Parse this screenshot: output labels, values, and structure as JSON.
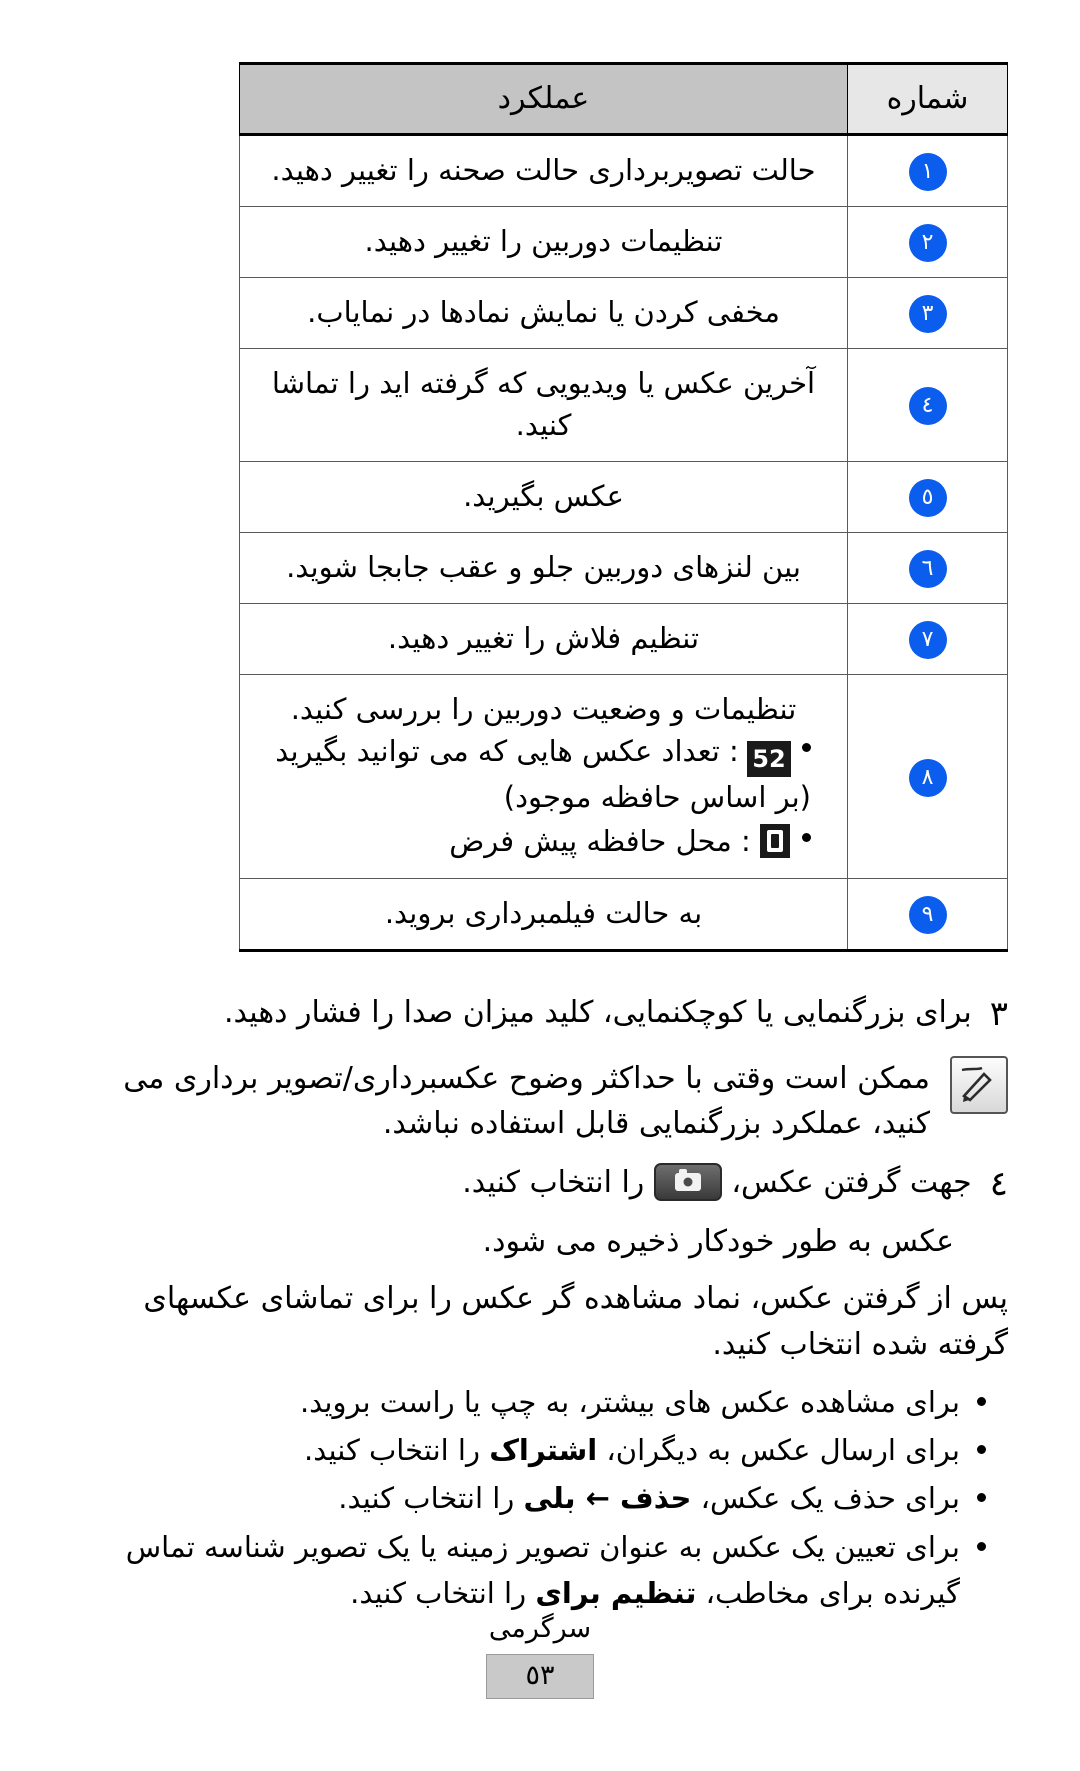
{
  "table": {
    "header": {
      "number_col": "شماره",
      "function_col": "عملکرد"
    },
    "rows": [
      {
        "num": "١",
        "text": "حالت تصویربرداری حالت صحنه را تغییر دهید."
      },
      {
        "num": "٢",
        "text": "تنظیمات دوربین را تغییر دهید."
      },
      {
        "num": "٣",
        "text": "مخفی کردن یا نمایش نمادها در نمایاب."
      },
      {
        "num": "٤",
        "text": "آخرین عکس یا ویدیویی که گرفته اید را تماشا کنید."
      },
      {
        "num": "٥",
        "text": "عکس بگیرید."
      },
      {
        "num": "٦",
        "text": "بین لنزهای دوربین جلو و عقب جابجا شوید."
      },
      {
        "num": "٧",
        "text": "تنظیم فلاش را تغییر دهید."
      },
      {
        "num": "٨",
        "text": "تنظیمات و وضعیت دوربین را بررسی کنید."
      },
      {
        "num": "٩",
        "text": "به حالت فیلمبرداری بروید."
      }
    ],
    "row8_bullets": [
      {
        "icon": "counter-52-icon",
        "icon_label": "52",
        "text_before": " : تعداد عکس هایی که می توانید بگیرید (بر اساس حافظه موجود)"
      },
      {
        "icon": "memory-location-icon",
        "icon_label": "",
        "text_before": " : محل حافظه پیش فرض"
      }
    ]
  },
  "steps": [
    {
      "num": "٣",
      "text": "برای بزرگنمایی یا کوچکنمایی، کلید میزان صدا را فشار دهید."
    },
    {
      "num": "٤",
      "text_before": "جهت گرفتن عکس، ",
      "icon": "camera-shutter-icon",
      "text_after": " را انتخاب کنید."
    }
  ],
  "note": {
    "icon": "note-pencil-icon",
    "text": "ممکن است وقتی با حداکثر وضوح عکسبرداری/تصویر برداری می کنید، عملکرد بزرگنمایی قابل استفاده نباشد."
  },
  "paragraphs": {
    "autosave": "عکس به طور خودکار ذخیره می شود.",
    "after_capture": "پس از گرفتن عکس، نماد مشاهده گر عکس را برای تماشای عکسهای گرفته شده انتخاب کنید."
  },
  "options": [
    {
      "text": "برای مشاهده عکس های بیشتر، به چپ یا راست بروید."
    },
    {
      "text_before": "برای ارسال عکس به دیگران، ",
      "bold": "اشتراک",
      "text_after": " را انتخاب کنید."
    },
    {
      "text_before": "برای حذف یک عکس، ",
      "bold": "حذف ← بلی",
      "text_after": " را انتخاب کنید."
    },
    {
      "text_before": "برای تعیین یک عکس به عنوان تصویر زمینه یا یک تصویر شناسه تماس گیرنده برای مخاطب، ",
      "bold": "تنظیم برای",
      "text_after": " را انتخاب کنید."
    }
  ],
  "footer": {
    "section_title": "سرگرمی",
    "page_number": "٥٣"
  }
}
